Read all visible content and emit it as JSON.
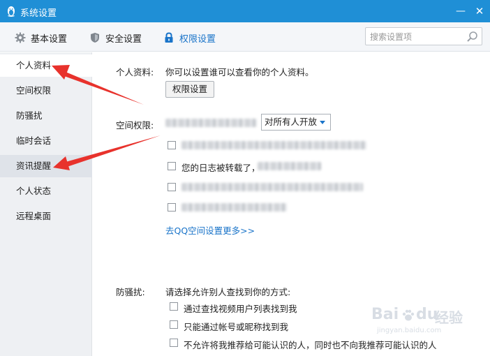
{
  "window": {
    "title": "系统设置",
    "minimize": "—",
    "close": "✕"
  },
  "toolbar": {
    "tabs": [
      {
        "label": "基本设置",
        "icon": "gear-icon"
      },
      {
        "label": "安全设置",
        "icon": "shield-icon"
      },
      {
        "label": "权限设置",
        "icon": "lock-icon",
        "active": true
      }
    ]
  },
  "search": {
    "placeholder": "搜索设置项",
    "value": ""
  },
  "sidebar": {
    "items": [
      {
        "label": "个人资料",
        "selected": true
      },
      {
        "label": "空间权限"
      },
      {
        "label": "防骚扰"
      },
      {
        "label": "临时会话"
      },
      {
        "label": "资讯提醒",
        "highlighted": true
      },
      {
        "label": "个人状态"
      },
      {
        "label": "远程桌面"
      }
    ]
  },
  "profile": {
    "label": "个人资料:",
    "description": "你可以设置谁可以查看你的个人资料。",
    "button": "权限设置"
  },
  "space": {
    "label": "空间权限:",
    "dropdown": "对所有人开放",
    "option2_text": "您的日志被转载了，",
    "link": "去QQ空间设置更多>>"
  },
  "anti_harass": {
    "label": "防骚扰:",
    "description": "请选择允许别人查找到你的方式:",
    "options": [
      "通过查找视频用户列表找到我",
      "只能通过帐号或昵称找到我",
      "不允许将我推荐给可能认识的人，同时也不向我推荐可能认识的人"
    ]
  },
  "watermark": {
    "brand": "Bai",
    "paw": "du",
    "cn": "经验",
    "url": "jingyan.baidu.com"
  },
  "colors": {
    "titlebar": "#1f8fd6",
    "accent": "#1a74c9",
    "arrow": "#e8322c"
  }
}
